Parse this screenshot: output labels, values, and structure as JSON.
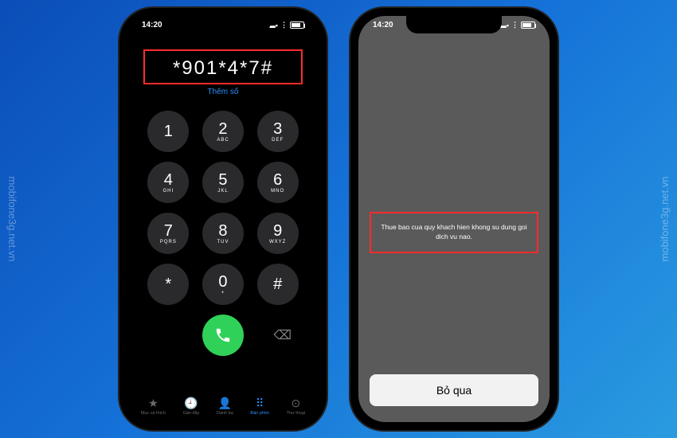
{
  "watermark": "mobifone3g.net.vn",
  "status": {
    "time": "14:20",
    "battery": "77"
  },
  "dialer": {
    "entered_number": "*901*4*7#",
    "add_number_label": "Thêm số",
    "keys": [
      {
        "num": "1",
        "sub": ""
      },
      {
        "num": "2",
        "sub": "ABC"
      },
      {
        "num": "3",
        "sub": "DEF"
      },
      {
        "num": "4",
        "sub": "GHI"
      },
      {
        "num": "5",
        "sub": "JKL"
      },
      {
        "num": "6",
        "sub": "MNO"
      },
      {
        "num": "7",
        "sub": "PQRS"
      },
      {
        "num": "8",
        "sub": "TUV"
      },
      {
        "num": "9",
        "sub": "WXYZ"
      },
      {
        "num": "*",
        "sub": ""
      },
      {
        "num": "0",
        "sub": "+"
      },
      {
        "num": "#",
        "sub": ""
      }
    ]
  },
  "tabs": [
    {
      "label": "Mục cả thích",
      "icon": "★"
    },
    {
      "label": "Gần đây",
      "icon": "🕘"
    },
    {
      "label": "Danh bạ",
      "icon": "👤"
    },
    {
      "label": "Bàn phím",
      "icon": "⠿"
    },
    {
      "label": "Thư thoại",
      "icon": "⊙"
    }
  ],
  "result": {
    "message": "Thue bao cua quy khach hien khong su dung goi dich vu nao.",
    "dismiss_label": "Bỏ qua"
  }
}
